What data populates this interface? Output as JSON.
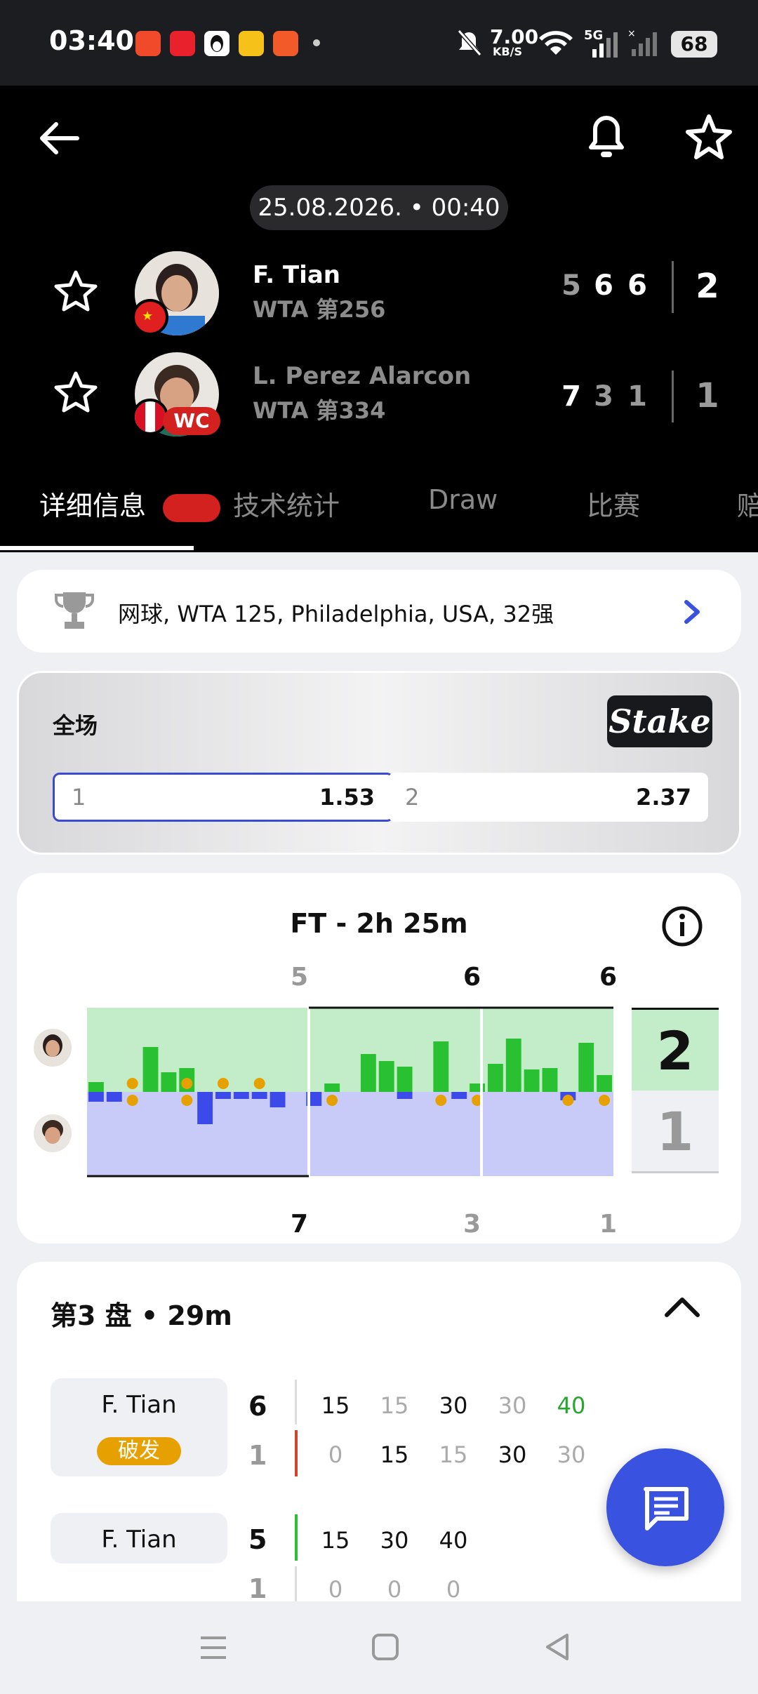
{
  "status_bar": {
    "time": "03:40",
    "net_speed_value": "7.00",
    "net_speed_unit": "KB/S",
    "signal": "5G",
    "battery": "68"
  },
  "header": {
    "date_time": "25.08.2026. • 00:40",
    "players": [
      {
        "name": "F. Tian",
        "rank": "WTA 第256",
        "sets": [
          "5",
          "6",
          "6"
        ],
        "total": "2"
      },
      {
        "name": "L. Perez Alarcon",
        "rank": "WTA 第334",
        "badge": "WC",
        "sets": [
          "7",
          "3",
          "1"
        ],
        "total": "1"
      }
    ]
  },
  "tabs": [
    "详细信息",
    "技术统计",
    "Draw",
    "比赛",
    "赔"
  ],
  "tournament": "网球, WTA 125, Philadelphia, USA, 32强",
  "odds": {
    "label": "全场",
    "brand": "Stake",
    "options": [
      {
        "key": "1",
        "value": "1.53"
      },
      {
        "key": "2",
        "value": "2.37"
      }
    ]
  },
  "momentum": {
    "title": "FT - 2h 25m",
    "top_set_scores": [
      "5",
      "6",
      "6"
    ],
    "bottom_set_scores": [
      "7",
      "3",
      "1"
    ],
    "total_top": "2",
    "total_bottom": "1"
  },
  "set_detail": {
    "title": "第3 盘 • 29m",
    "rows": [
      {
        "server": "F. Tian",
        "tag": "破发",
        "top_game": "6",
        "bottom_game": "1",
        "top_points": [
          "15",
          "15",
          "30",
          "30",
          "40"
        ],
        "bottom_points": [
          "0",
          "15",
          "15",
          "30",
          "30"
        ]
      },
      {
        "server": "F. Tian",
        "top_game": "5",
        "bottom_game": "1",
        "top_points": [
          "15",
          "30",
          "40"
        ],
        "bottom_points": [
          "0",
          "0",
          "0"
        ]
      }
    ]
  },
  "colors": {
    "green": "#29c031",
    "blue": "#3b4ae8",
    "accent": "#3a52e0",
    "break_badge": "#e6a100",
    "break_line": "#d0432d"
  }
}
